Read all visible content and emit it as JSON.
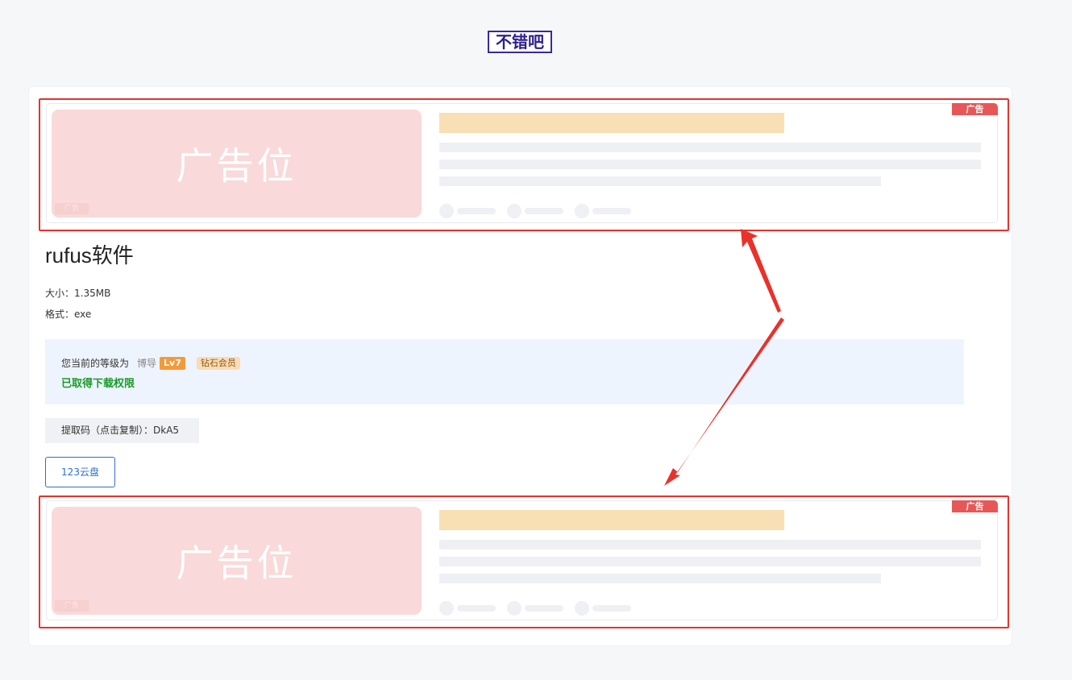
{
  "logo": {
    "text": "不错吧"
  },
  "ad_top": {
    "image_text": "广告位",
    "mini_label": "广告",
    "badge": "广告"
  },
  "ad_bottom": {
    "image_text": "广告位",
    "mini_label": "广告",
    "badge": "广告"
  },
  "file": {
    "title": "rufus软件",
    "size_line": "大小：1.35MB",
    "format_line": "格式：exe"
  },
  "level": {
    "prefix": "您当前的等级为",
    "name": "博导",
    "lv": "Lv7",
    "vip": "钻石会员",
    "access": "已取得下载权限"
  },
  "extract_code": {
    "text": "提取码（点击复制）：DkA5"
  },
  "download": {
    "label": "123云盘"
  },
  "colors": {
    "annotation_red": "#e8322b",
    "ad_pink": "#f9d9d9",
    "accent_blue": "#2a6fd6",
    "access_green": "#1a9b2a"
  }
}
